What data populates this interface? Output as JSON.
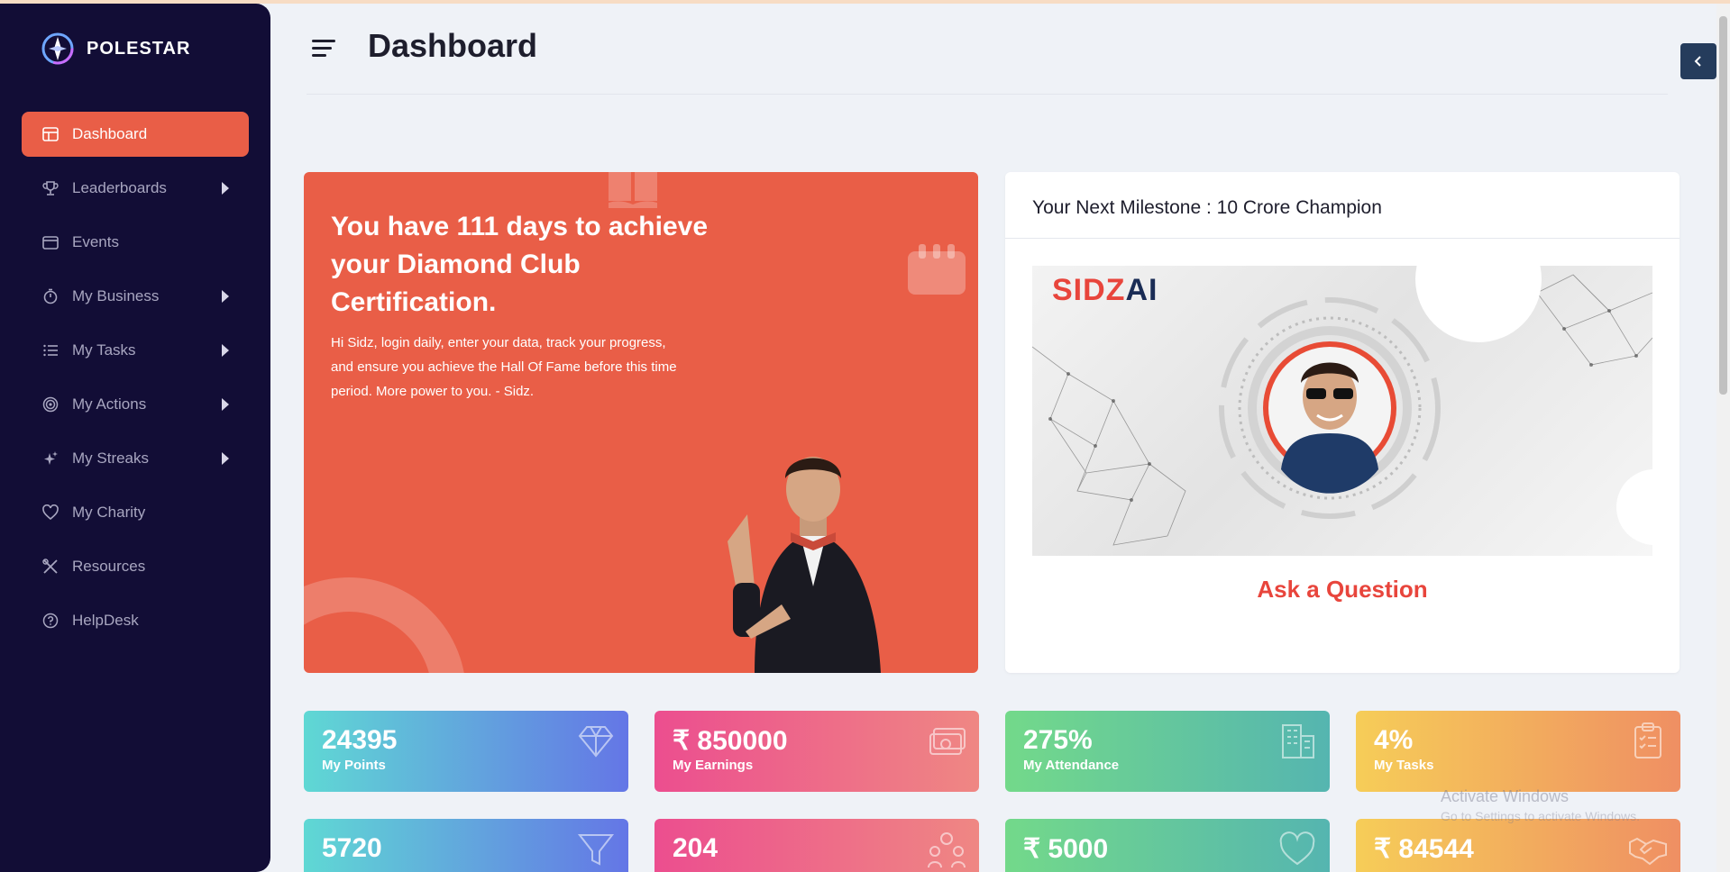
{
  "sidebar": {
    "brand": "POLESTAR",
    "items": [
      {
        "label": "Dashboard",
        "icon": "dashboard-icon",
        "active": true
      },
      {
        "label": "Leaderboards",
        "icon": "trophy-icon"
      },
      {
        "label": "Events",
        "icon": "calendar-icon"
      },
      {
        "label": "My Business",
        "icon": "stopwatch-icon"
      },
      {
        "label": "My Tasks",
        "icon": "list-icon"
      },
      {
        "label": "My Actions",
        "icon": "target-icon"
      },
      {
        "label": "My Streaks",
        "icon": "sparkle-icon"
      },
      {
        "label": "My Charity",
        "icon": "heart-icon"
      },
      {
        "label": "Resources",
        "icon": "tools-icon"
      },
      {
        "label": "HelpDesk",
        "icon": "help-icon"
      }
    ]
  },
  "header": {
    "title": "Dashboard"
  },
  "banner": {
    "headline": "You have 111 days to achieve your Diamond Club Certification.",
    "text": "Hi Sidz, login daily, enter your data, track your progress, and ensure you achieve the Hall Of Fame before this time period. More power to you. - Sidz."
  },
  "milestone": {
    "title": "Your Next Milestone : 10 Crore Champion",
    "logo_part1": "SIDZ",
    "logo_part2": "AI",
    "ask_label": "Ask a Question"
  },
  "stats_row1": [
    {
      "value": "24395",
      "label": "My Points",
      "icon": "diamond-icon"
    },
    {
      "value": "₹ 850000",
      "label": "My Earnings",
      "icon": "cash-icon"
    },
    {
      "value": "275%",
      "label": "My Attendance",
      "icon": "building-icon"
    },
    {
      "value": "4%",
      "label": "My Tasks",
      "icon": "clipboard-icon"
    }
  ],
  "stats_row2": [
    {
      "value": "5720",
      "icon": "funnel-icon"
    },
    {
      "value": "204",
      "icon": "people-icon"
    },
    {
      "value": "₹ 5000",
      "icon": "heart-icon"
    },
    {
      "value": "₹ 84544",
      "icon": "handshake-icon"
    }
  ],
  "watermark": {
    "title": "Activate Windows",
    "subtitle": "Go to Settings to activate Windows."
  },
  "colors": {
    "sidebar_bg": "#120d36",
    "accent": "#e95e47",
    "ask_red": "#e8453c"
  }
}
